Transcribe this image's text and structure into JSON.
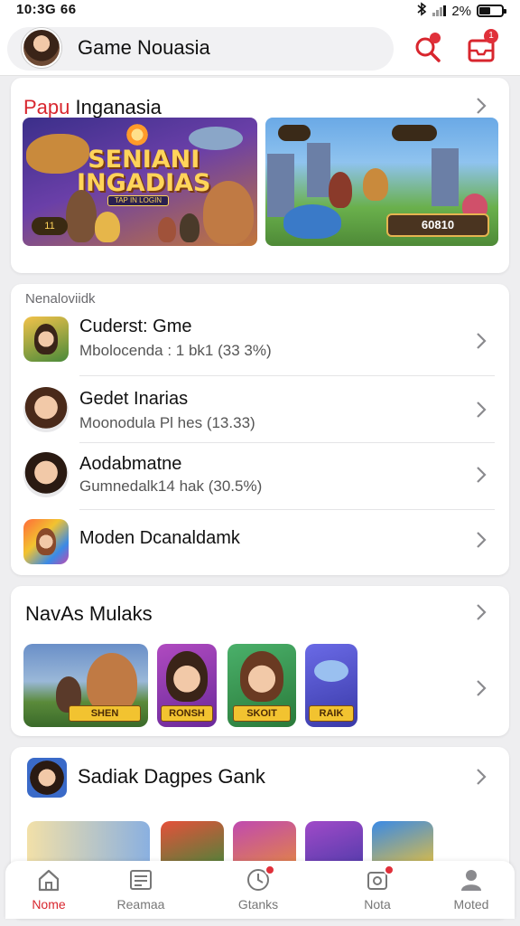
{
  "status_bar": {
    "time": "10:3G 66",
    "battery": "2%"
  },
  "header": {
    "title": "Game Nouasia",
    "notif_count": "1"
  },
  "featured": {
    "title_accent": "Papu",
    "title_rest": " Inganasia",
    "banner1_logo": "SENIANI\nINGADIAS",
    "banner1_strip": "TAP IN LOGIN",
    "banner1_coin": "11",
    "banner2_score": "60810"
  },
  "list_section": {
    "subtitle": "Nenaloviidk",
    "items": [
      {
        "title": "Cuderst: Gme",
        "subtitle": "Mbolocenda : 1 bk1 (33 3%)"
      },
      {
        "title": "Gedet Inarias",
        "subtitle": "Moonodula Pl hes (13.33)"
      },
      {
        "title": "Aodabmatne",
        "subtitle": "Gumnedalk14 hak (30.5%)"
      },
      {
        "title": "Moden Dcanaldamk",
        "subtitle": ""
      }
    ]
  },
  "new_section": {
    "title": "NavAs Mulaks",
    "tiles": [
      {
        "label": "SHEN"
      },
      {
        "label": "RONSH"
      },
      {
        "label": "SKOIT"
      },
      {
        "label": "RAIK"
      }
    ]
  },
  "bottom_section": {
    "title": "Sadiak Dagpes Gank"
  },
  "bottom_nav": [
    {
      "label": "Nome",
      "icon": "home-icon",
      "active": true
    },
    {
      "label": "Reamaa",
      "icon": "news-icon"
    },
    {
      "label": "Gtanks",
      "icon": "games-icon"
    },
    {
      "label": "Nota",
      "icon": "notes-icon"
    },
    {
      "label": "Moted",
      "icon": "profile-icon"
    }
  ],
  "colors": {
    "accent": "#d8262e",
    "badge": "#e0303a"
  }
}
